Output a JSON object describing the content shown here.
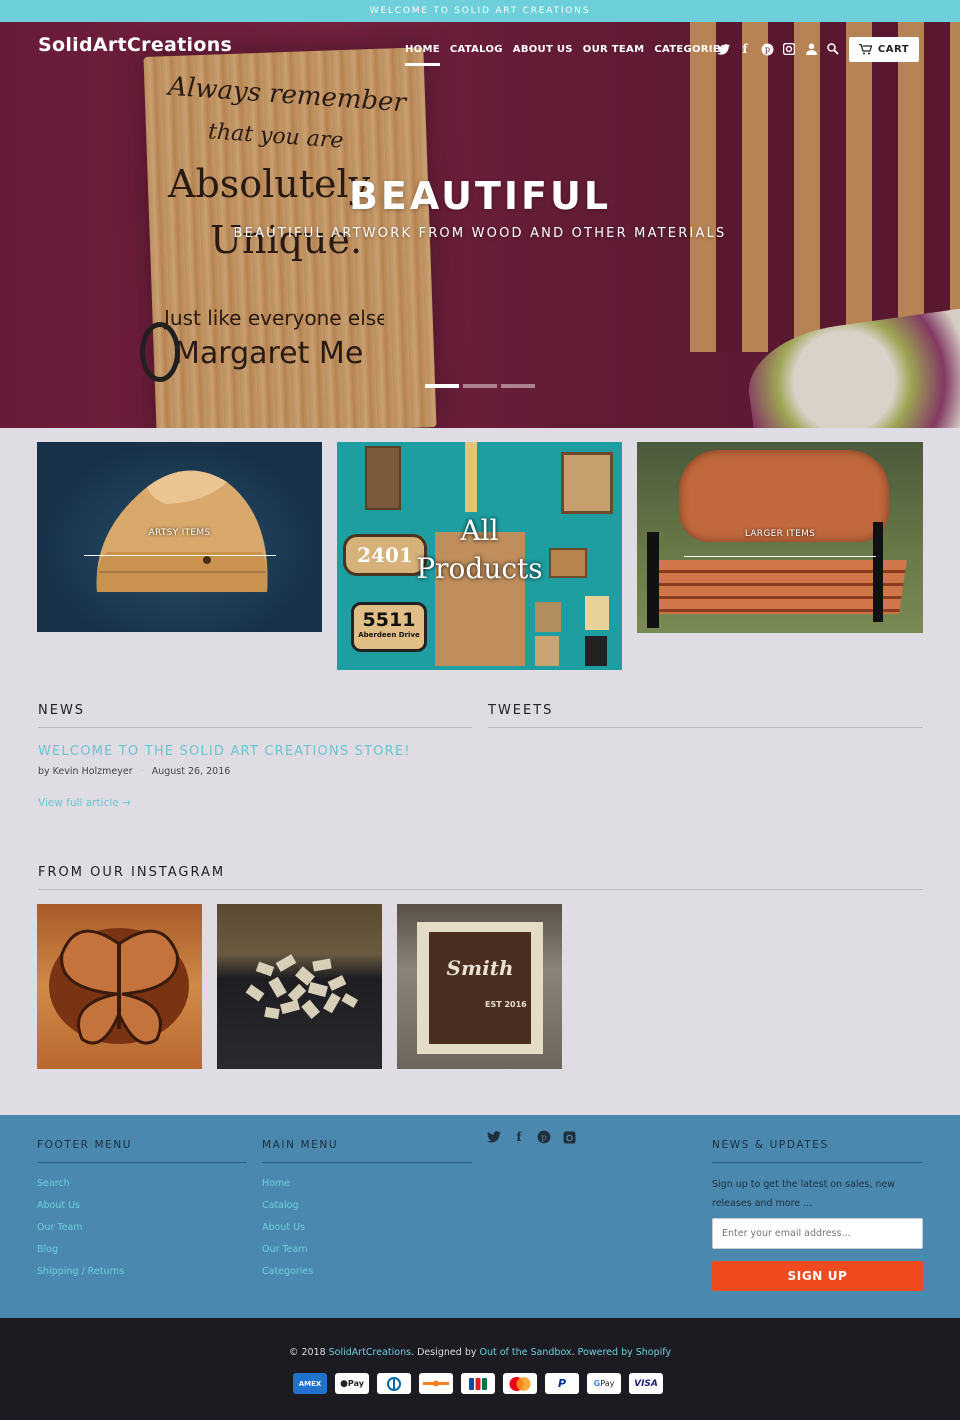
{
  "announcement": "WELCOME TO SOLID ART CREATIONS",
  "header": {
    "logo": "SolidArtCreations",
    "nav": [
      "HOME",
      "CATALOG",
      "ABOUT US",
      "OUR TEAM",
      "CATEGORIES"
    ],
    "icons": [
      "twitter-icon",
      "facebook-icon",
      "pinterest-icon",
      "instagram-icon",
      "account-icon",
      "search-icon"
    ],
    "cart_label": "CART"
  },
  "hero": {
    "title": "BEAUTIFUL",
    "subtitle": "BEAUTIFUL ARTWORK FROM WOOD AND OTHER MATERIALS",
    "sign_lines": [
      "Always remember",
      "that you are",
      "Absolutely",
      "Unique.",
      "Just like everyone else",
      "Margaret Me"
    ],
    "slides": 3,
    "active_slide": 1
  },
  "collections": {
    "artsy": "ARTSY ITEMS",
    "all_products_1": "All",
    "all_products_2": "Products",
    "plaque_1": "2401",
    "plaque_2": "5511",
    "plaque_2_sub": "Aberdeen Drive",
    "larger": "LARGER ITEMS"
  },
  "news": {
    "heading": "NEWS",
    "article_title": "WELCOME TO THE SOLID ART CREATIONS STORE!",
    "author": "by Kevin Holzmeyer",
    "date": "August 26, 2016",
    "read_more": "View full article →"
  },
  "tweets": {
    "heading": "TWEETS"
  },
  "instagram": {
    "heading": "FROM OUR INSTAGRAM",
    "plaque_name": "Smith",
    "plaque_est": "EST 2016"
  },
  "footer": {
    "footer_menu_heading": "FOOTER MENU",
    "footer_menu": [
      "Search",
      "About Us",
      "Our Team",
      "Blog",
      "Shipping / Returns"
    ],
    "main_menu_heading": "MAIN MENU",
    "main_menu": [
      "Home",
      "Catalog",
      "About Us",
      "Our Team",
      "Categories"
    ],
    "newsletter_heading": "NEWS & UPDATES",
    "newsletter_text": "Sign up to get the latest on sales, new releases and more ...",
    "email_placeholder": "Enter your email address...",
    "signup_label": "SIGN UP"
  },
  "bottom": {
    "copy_prefix": "© 2018 ",
    "copy_brand": "SolidArtCreations",
    "copy_mid": ". Designed by ",
    "copy_designer": "Out of the Sandbox",
    "copy_dot": ". ",
    "copy_powered": "Powered by Shopify",
    "payments": [
      "AMEX",
      "Pay",
      "D",
      "",
      "JCB",
      "",
      "P",
      "Pay",
      "VISA"
    ]
  },
  "colors": {
    "accent": "#6ccfd9",
    "footer_bg": "#4b88af",
    "signup": "#f04a1e",
    "bottom_bg": "#1d1b22"
  }
}
